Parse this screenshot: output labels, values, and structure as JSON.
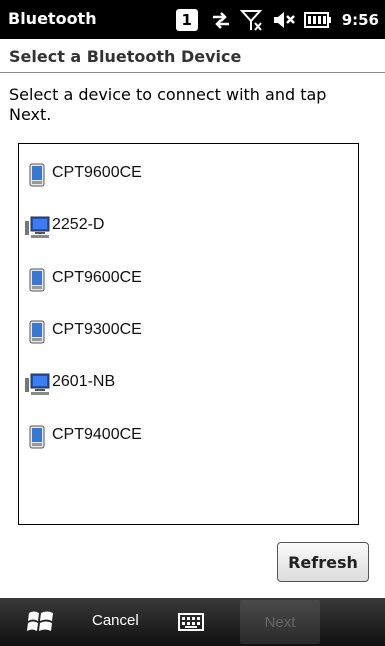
{
  "status_bar": {
    "app_title": "Bluetooth",
    "notification_count": "1",
    "clock": "9:56",
    "icons": [
      "sync-arrows-icon",
      "no-signal-icon",
      "speaker-muted-icon",
      "battery-icon"
    ]
  },
  "header": {
    "title": "Select a Bluetooth Device"
  },
  "instructions": "Select a device to connect with and tap Next.",
  "devices": [
    {
      "label": "CPT9600CE",
      "icon": "handheld-device-icon"
    },
    {
      "label": "2252-D",
      "icon": "computer-icon"
    },
    {
      "label": "CPT9600CE",
      "icon": "handheld-device-icon"
    },
    {
      "label": "CPT9300CE",
      "icon": "handheld-device-icon"
    },
    {
      "label": "2601-NB",
      "icon": "computer-icon"
    },
    {
      "label": "CPT9400CE",
      "icon": "handheld-device-icon"
    }
  ],
  "buttons": {
    "refresh": "Refresh"
  },
  "softkeys": {
    "cancel": "Cancel",
    "next": "Next"
  },
  "colors": {
    "status_bar_bg": "#000000",
    "softbar_bg": "#1a1a1a",
    "handheld_screen": "#3a78d0",
    "disabled_text": "#666666"
  }
}
